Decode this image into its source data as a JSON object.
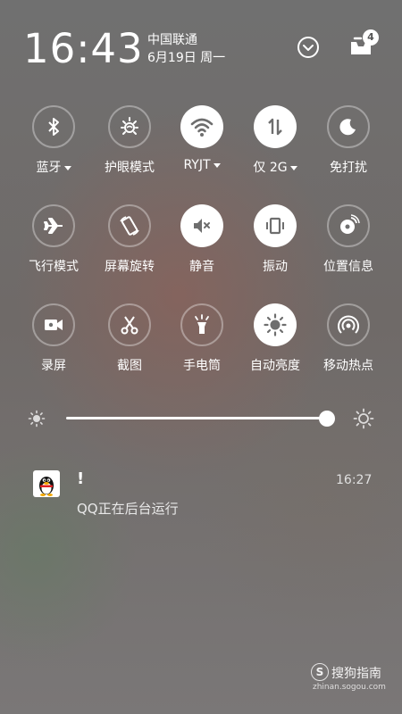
{
  "header": {
    "time": "16:43",
    "carrier": "中国联通",
    "date": "6月19日 周一",
    "notification_count": "4"
  },
  "tiles": [
    {
      "label": "蓝牙",
      "icon": "bluetooth-icon",
      "active": false,
      "dropdown": true
    },
    {
      "label": "护眼模式",
      "icon": "eye-care-icon",
      "active": false,
      "dropdown": false
    },
    {
      "label": "RYJT",
      "icon": "wifi-icon",
      "active": true,
      "dropdown": true
    },
    {
      "label": "仅 2G",
      "icon": "mobile-data-icon",
      "active": true,
      "dropdown": true
    },
    {
      "label": "免打扰",
      "icon": "moon-icon",
      "active": false,
      "dropdown": false
    },
    {
      "label": "飞行模式",
      "icon": "airplane-icon",
      "active": false,
      "dropdown": false
    },
    {
      "label": "屏幕旋转",
      "icon": "rotate-icon",
      "active": false,
      "dropdown": false
    },
    {
      "label": "静音",
      "icon": "mute-icon",
      "active": true,
      "dropdown": false
    },
    {
      "label": "振动",
      "icon": "vibrate-icon",
      "active": true,
      "dropdown": false
    },
    {
      "label": "位置信息",
      "icon": "location-icon",
      "active": false,
      "dropdown": false
    },
    {
      "label": "录屏",
      "icon": "screen-record-icon",
      "active": false,
      "dropdown": false
    },
    {
      "label": "截图",
      "icon": "screenshot-icon",
      "active": false,
      "dropdown": false
    },
    {
      "label": "手电筒",
      "icon": "flashlight-icon",
      "active": false,
      "dropdown": false
    },
    {
      "label": "自动亮度",
      "icon": "auto-brightness-icon",
      "active": true,
      "dropdown": false
    },
    {
      "label": "移动热点",
      "icon": "hotspot-icon",
      "active": false,
      "dropdown": false
    }
  ],
  "brightness": {
    "level": 0.99
  },
  "notification": {
    "app_icon": "qq-icon",
    "title": "!",
    "time": "16:27",
    "text": "QQ正在后台运行"
  },
  "watermark": {
    "brand": "搜狗指南",
    "url": "zhinan.sogou.com",
    "logo_char": "S"
  },
  "colors": {
    "active_circle": "#ffffff",
    "active_icon": "#6e6e6e",
    "inactive_ring": "rgba(255,255,255,0.35)"
  }
}
